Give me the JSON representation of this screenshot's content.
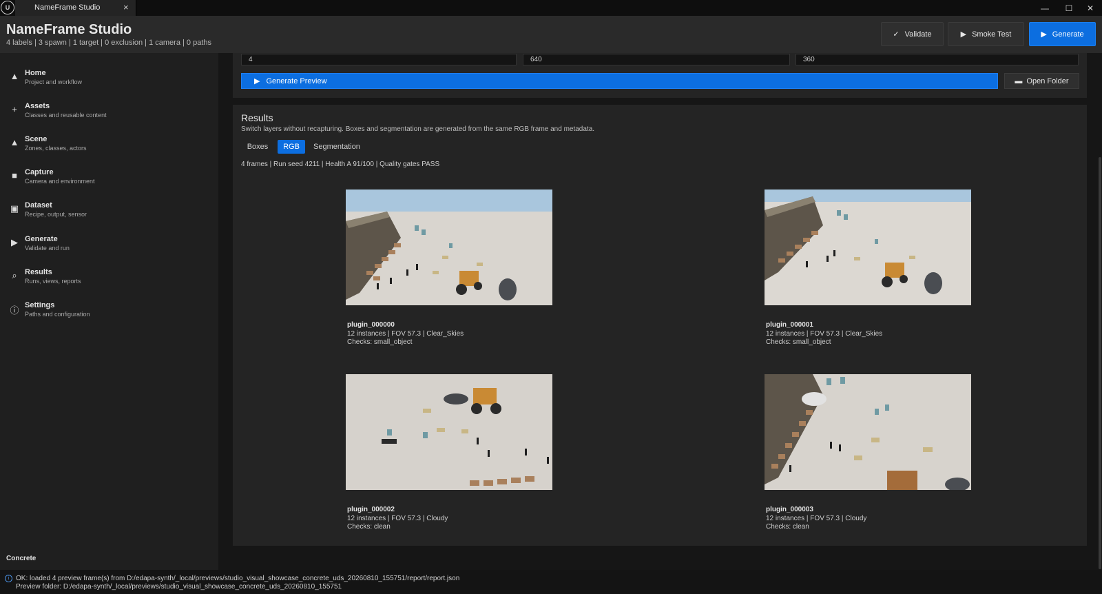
{
  "window": {
    "logo_text": "U",
    "tab_title": "NameFrame Studio",
    "tab_close": "×",
    "minimize": "—",
    "maximize": "☐",
    "close": "✕"
  },
  "header": {
    "title": "NameFrame Studio",
    "stats": "4 labels  |  3 spawn  |  1 target  |  0 exclusion  |  1 camera  |  0 paths",
    "validate_label": "Validate",
    "smoke_test_label": "Smoke Test",
    "generate_label": "Generate"
  },
  "sidebar": {
    "items": [
      {
        "label": "Home",
        "sub": "Project and workflow",
        "icon": "home-icon",
        "glyph": "▲"
      },
      {
        "label": "Assets",
        "sub": "Classes and reusable content",
        "icon": "plus-icon",
        "glyph": "+"
      },
      {
        "label": "Scene",
        "sub": "Zones, classes, actors",
        "icon": "scene-icon",
        "glyph": "▲"
      },
      {
        "label": "Capture",
        "sub": "Camera and environment",
        "icon": "camera-icon",
        "glyph": "■"
      },
      {
        "label": "Dataset",
        "sub": "Recipe, output, sensor",
        "icon": "save-icon",
        "glyph": "▣"
      },
      {
        "label": "Generate",
        "sub": "Validate and run",
        "icon": "play-icon",
        "glyph": "▶"
      },
      {
        "label": "Results",
        "sub": "Runs, views, reports",
        "icon": "search-icon",
        "glyph": "⌕"
      },
      {
        "label": "Settings",
        "sub": "Paths and configuration",
        "icon": "info-icon",
        "glyph": "ⓘ"
      }
    ],
    "footer": "Concrete"
  },
  "preview_config": {
    "count_value": "4",
    "width_value": "640",
    "height_value": "360",
    "generate_preview_label": "Generate Preview",
    "open_folder_label": "Open Folder"
  },
  "results": {
    "title": "Results",
    "subtitle": "Switch layers without recapturing. Boxes and segmentation are generated from the same RGB frame and metadata.",
    "tabs": [
      "Boxes",
      "RGB",
      "Segmentation"
    ],
    "active_tab": "RGB",
    "info": "4 frames  |  Run seed 4211  |  Health A 91/100  |  Quality gates PASS",
    "frames": [
      {
        "name": "plugin_000000",
        "meta": "12 instances  |  FOV 57.3  |  Clear_Skies",
        "checks": "Checks: small_object"
      },
      {
        "name": "plugin_000001",
        "meta": "12 instances  |  FOV 57.3  |  Clear_Skies",
        "checks": "Checks: small_object"
      },
      {
        "name": "plugin_000002",
        "meta": "12 instances  |  FOV 57.3  |  Cloudy",
        "checks": "Checks: clean"
      },
      {
        "name": "plugin_000003",
        "meta": "12 instances  |  FOV 57.3  |  Cloudy",
        "checks": "Checks: clean"
      }
    ]
  },
  "status": {
    "line1": "OK: loaded 4 preview frame(s) from D:/edapa-synth/_local/previews/studio_visual_showcase_concrete_uds_20260810_155751/report/report.json",
    "line2": "Preview folder: D:/edapa-synth/_local/previews/studio_visual_showcase_concrete_uds_20260810_155751"
  },
  "colors": {
    "accent": "#0c6ee0",
    "panel": "#242424",
    "background": "#161616"
  }
}
